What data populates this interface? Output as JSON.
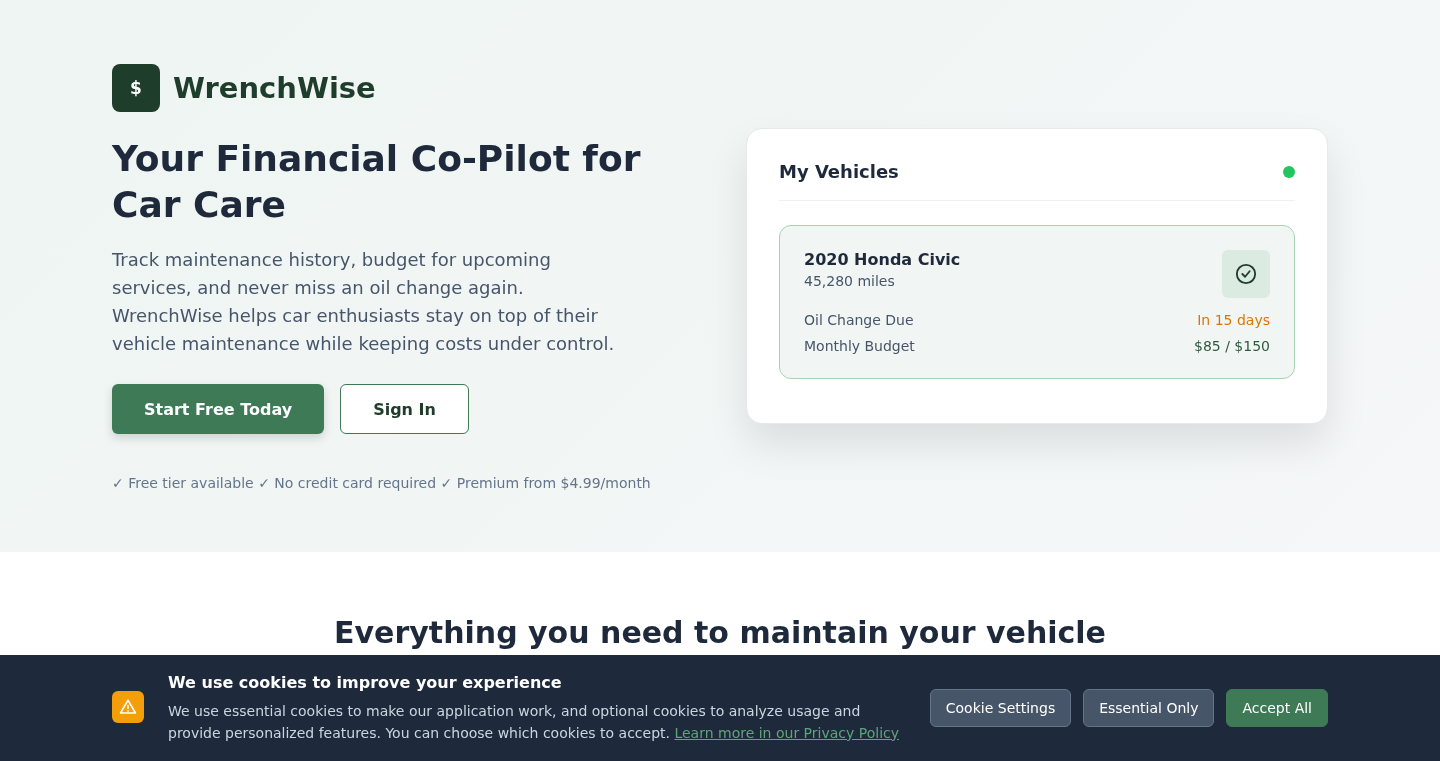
{
  "brand": {
    "logo": "$",
    "name": "WrenchWise"
  },
  "hero": {
    "title": "Your Financial Co-Pilot for Car Care",
    "description": "Track maintenance history, budget for upcoming services, and never miss an oil change again. WrenchWise helps car enthusiasts stay on top of their vehicle maintenance while keeping costs under control.",
    "buttons": [
      {
        "label": "Start Free Today",
        "kind": "primary"
      },
      {
        "label": "Sign In",
        "kind": "outline"
      }
    ],
    "perks": "✓ Free tier available ✓ No credit card required ✓ Premium from $4.99/month"
  },
  "vehicles_card": {
    "title": "My Vehicles",
    "status_dot": {
      "color": "#22c55e"
    },
    "vehicle": {
      "name": "2020 Honda Civic",
      "mileage": "45,280 miles",
      "details": [
        {
          "label": "Oil Change Due",
          "value": "In 15 days",
          "color": "#d97706"
        },
        {
          "label": "Monthly Budget",
          "value": "$85 / $150",
          "color": "#2f5a3f"
        }
      ]
    }
  },
  "features": {
    "title": "Everything you need to maintain your vehicle"
  },
  "cookie_banner": {
    "title": "We use cookies to improve your experience",
    "text": "We use essential cookies to make our application work, and optional cookies to analyze usage and provide personalized features. You can choose which cookies to accept.",
    "link": "Learn more in our Privacy Policy",
    "buttons": [
      {
        "label": "Cookie Settings",
        "kind": "secondary"
      },
      {
        "label": "Essential Only",
        "kind": "secondary"
      },
      {
        "label": "Accept All",
        "kind": "primary"
      }
    ]
  }
}
